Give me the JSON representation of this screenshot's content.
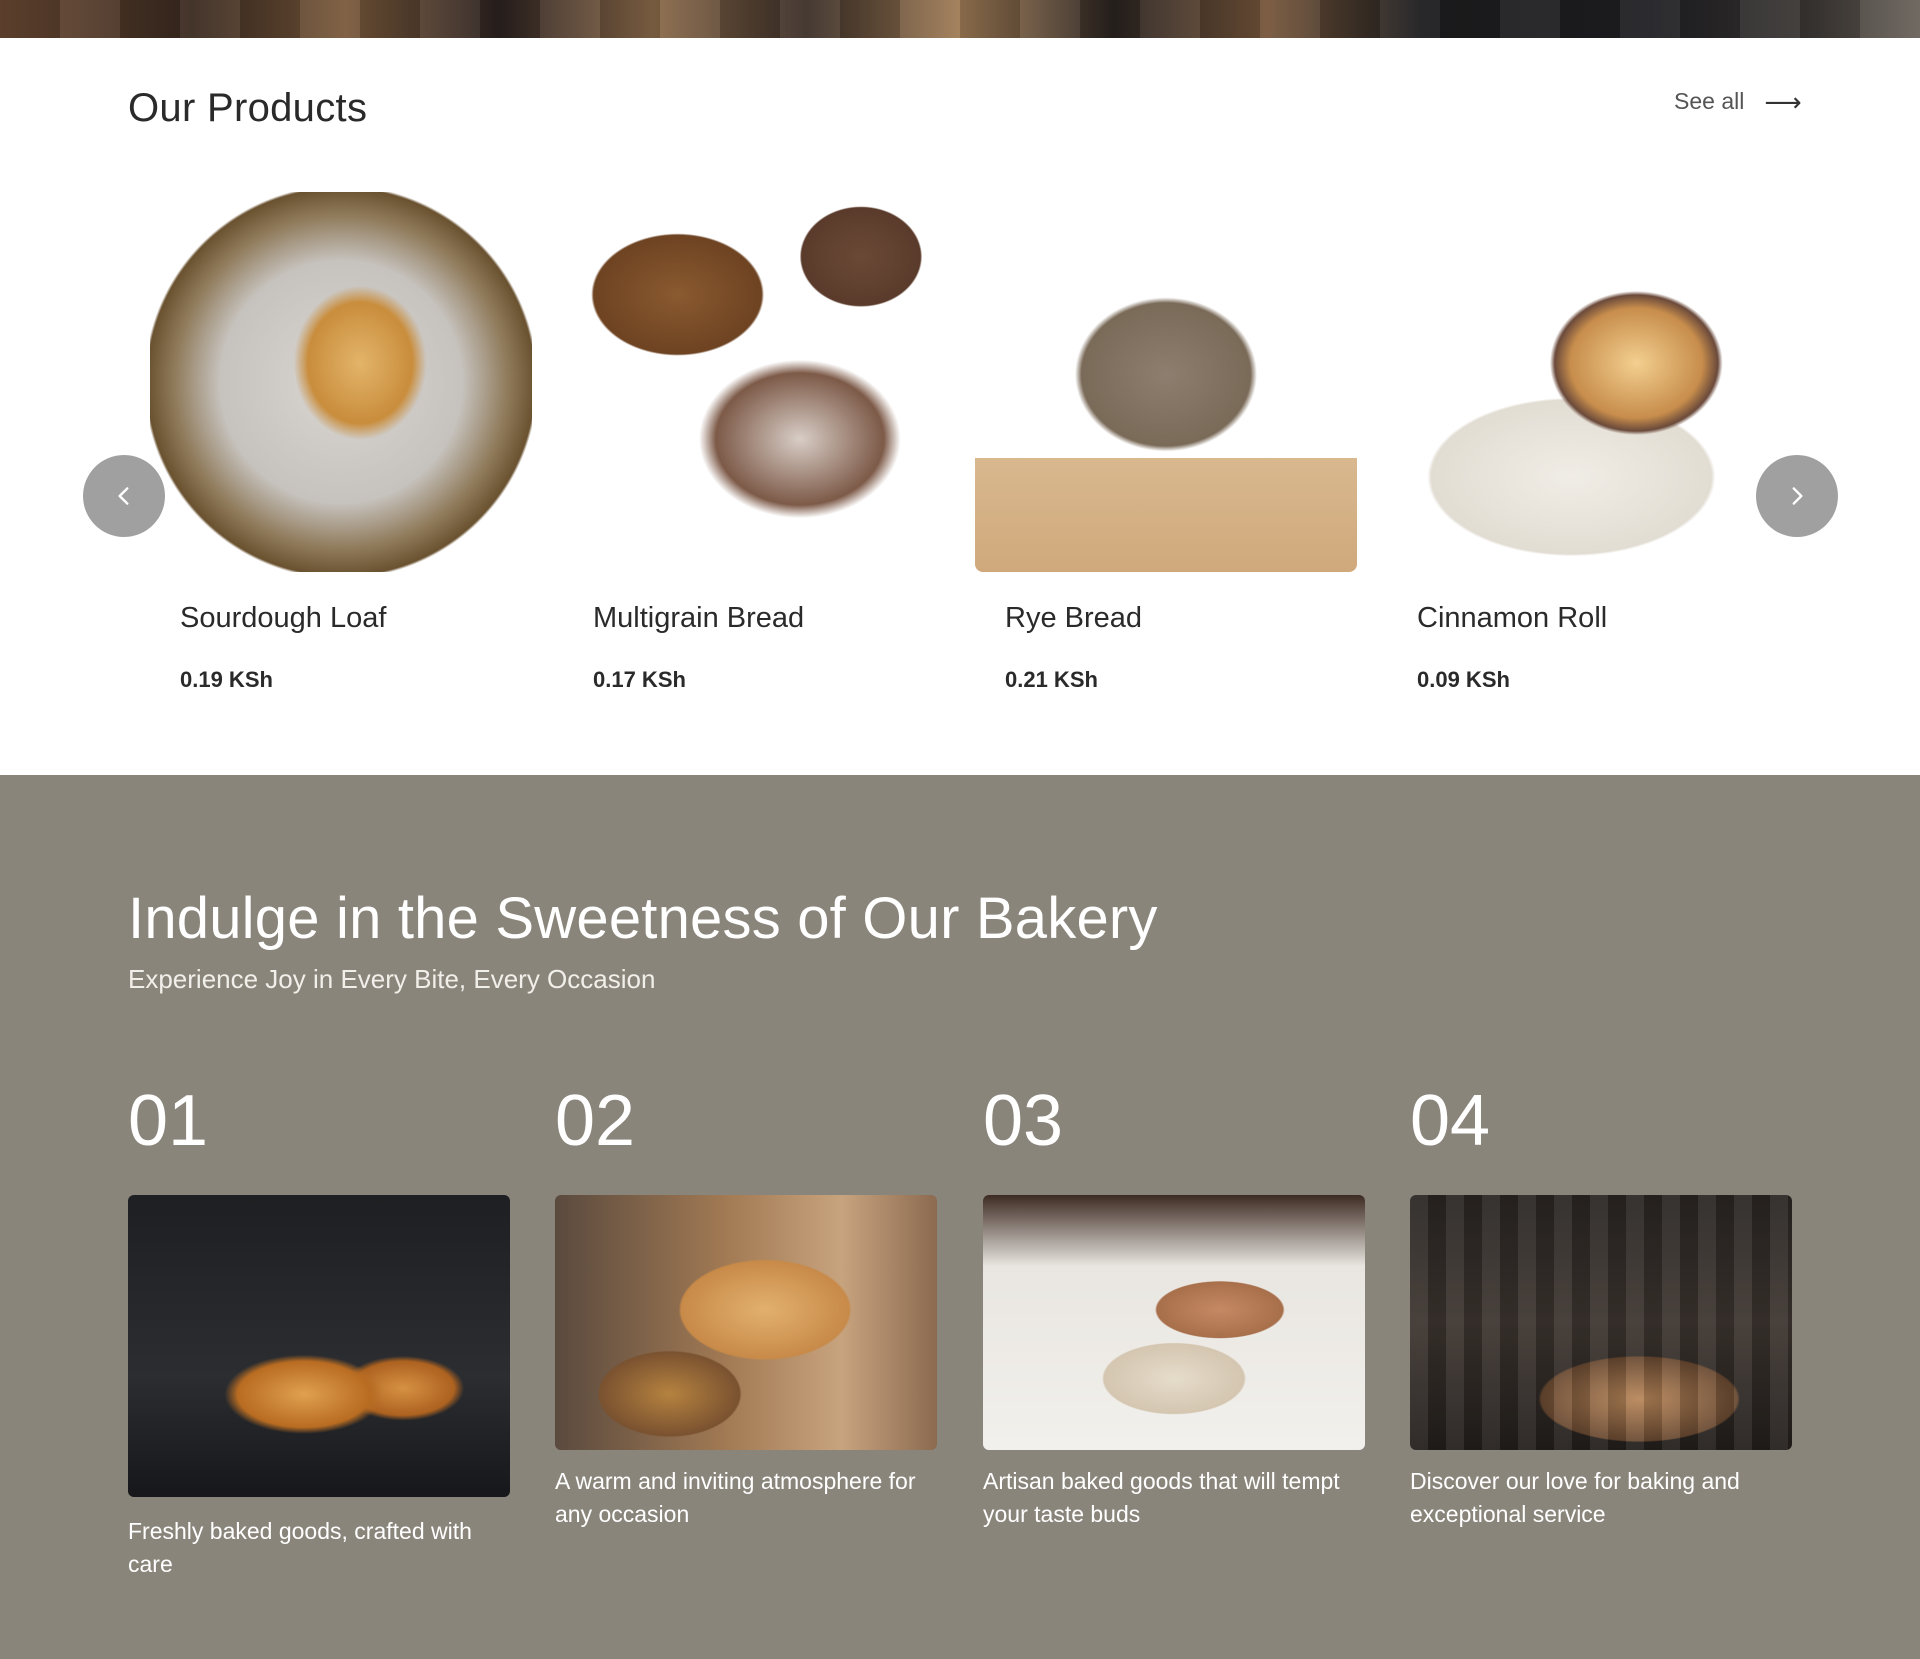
{
  "products_section": {
    "title": "Our Products",
    "see_all_label": "See all",
    "items": [
      {
        "name": "Sourdough Loaf",
        "price": "0.19 KSh"
      },
      {
        "name": "Multigrain Bread",
        "price": "0.17 KSh"
      },
      {
        "name": "Rye Bread",
        "price": "0.21 KSh"
      },
      {
        "name": "Cinnamon Roll",
        "price": "0.09 KSh"
      }
    ]
  },
  "bakery_section": {
    "title": "Indulge in the Sweetness of Our Bakery",
    "subtitle": "Experience Joy in Every Bite, Every Occasion",
    "features": [
      {
        "number": "01",
        "text": "Freshly baked goods, crafted with care"
      },
      {
        "number": "02",
        "text": "A warm and inviting atmosphere for any occasion"
      },
      {
        "number": "03",
        "text": "Artisan baked goods that will tempt your taste buds"
      },
      {
        "number": "04",
        "text": "Discover our love for baking and exceptional service"
      }
    ]
  },
  "colors": {
    "bakery_background": "#8a857b",
    "carousel_button": "#787878"
  },
  "icons": {
    "see_all": "arrow-right-icon",
    "prev": "chevron-left-icon",
    "next": "chevron-right-icon"
  }
}
